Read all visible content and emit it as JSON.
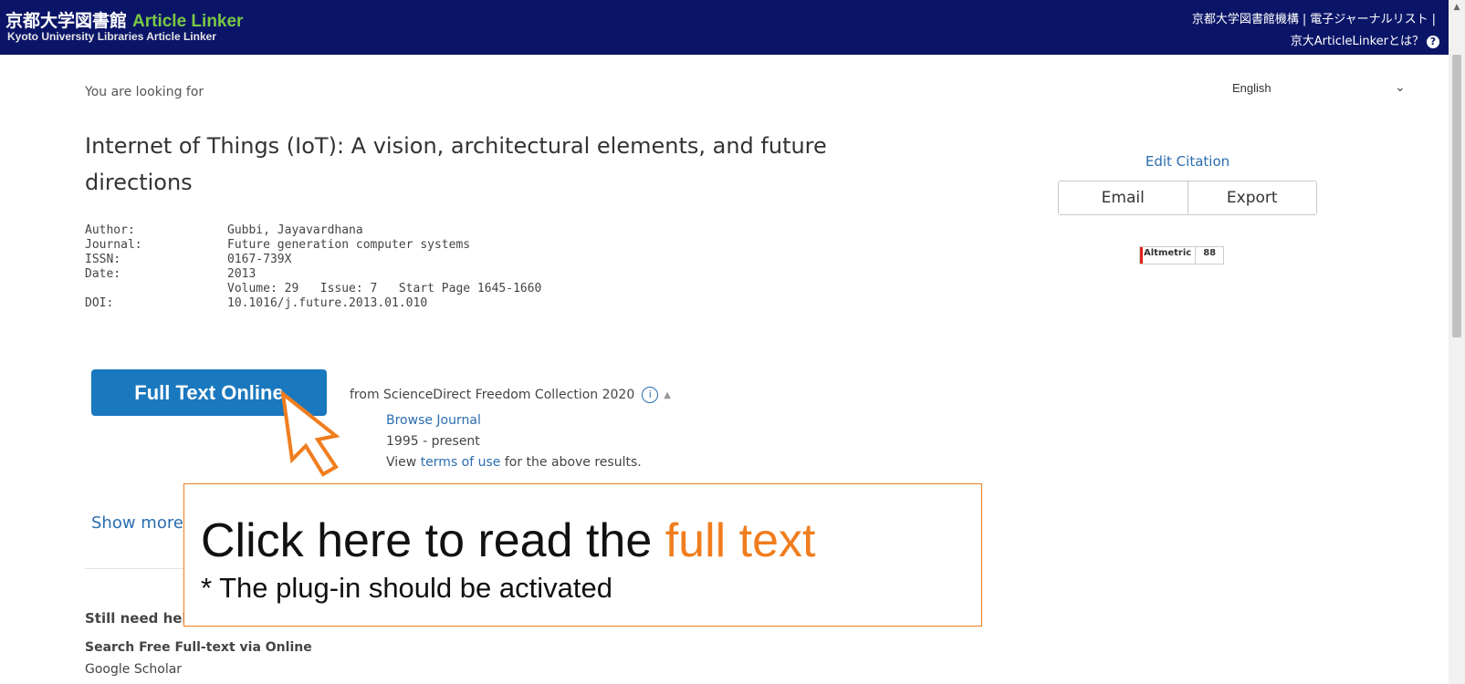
{
  "header": {
    "brand_ja": "京都大学図書館",
    "brand_en": "Article Linker",
    "subtitle": "Kyoto University Libraries Article Linker",
    "link_library": "京都大学図書館機構",
    "link_ejournal": "電子ジャーナルリスト",
    "link_about": "京大ArticleLinkerとは？",
    "separator": "|"
  },
  "language": {
    "selected": "English"
  },
  "looking_for": "You are looking for",
  "article": {
    "title": "Internet of Things (IoT): A vision, architectural elements, and future directions",
    "fields": [
      {
        "label": "Author:",
        "value": "Gubbi, Jayavardhana"
      },
      {
        "label": "Journal:",
        "value": "Future generation computer systems"
      },
      {
        "label": "ISSN:",
        "value": "0167-739X"
      },
      {
        "label": "Date:",
        "value": "2013"
      },
      {
        "label": "",
        "value": "Volume: 29   Issue: 7   Start Page 1645-1660"
      },
      {
        "label": "DOI:",
        "value": "10.1016/j.future.2013.01.010"
      }
    ]
  },
  "citation": {
    "edit_label": "Edit Citation",
    "email_label": "Email",
    "export_label": "Export"
  },
  "altmetric": {
    "label": "Altmetric",
    "score": "88"
  },
  "fulltext": {
    "button_label": "Full Text Online",
    "source": "from ScienceDirect Freedom Collection 2020",
    "info_symbol": "i",
    "browse_journal": "Browse Journal",
    "coverage": "1995 - present",
    "terms_prefix": "View ",
    "terms_link": "terms of use",
    "terms_suffix": " for the above results."
  },
  "show_more": "Show more full text options",
  "help": {
    "still_need_help": "Still need help?",
    "search_free": "Search Free Full-text via Online",
    "google_scholar": "Google Scholar"
  },
  "annotation": {
    "main_prefix": "Click here to read the ",
    "main_highlight": "full text",
    "sub": "* The plug-in should be activated",
    "accent_color": "#f07d1e"
  },
  "colors": {
    "header_bg": "#0b1568",
    "brand_accent": "#79c943",
    "primary_button": "#1a78be",
    "link": "#2a6db0"
  }
}
